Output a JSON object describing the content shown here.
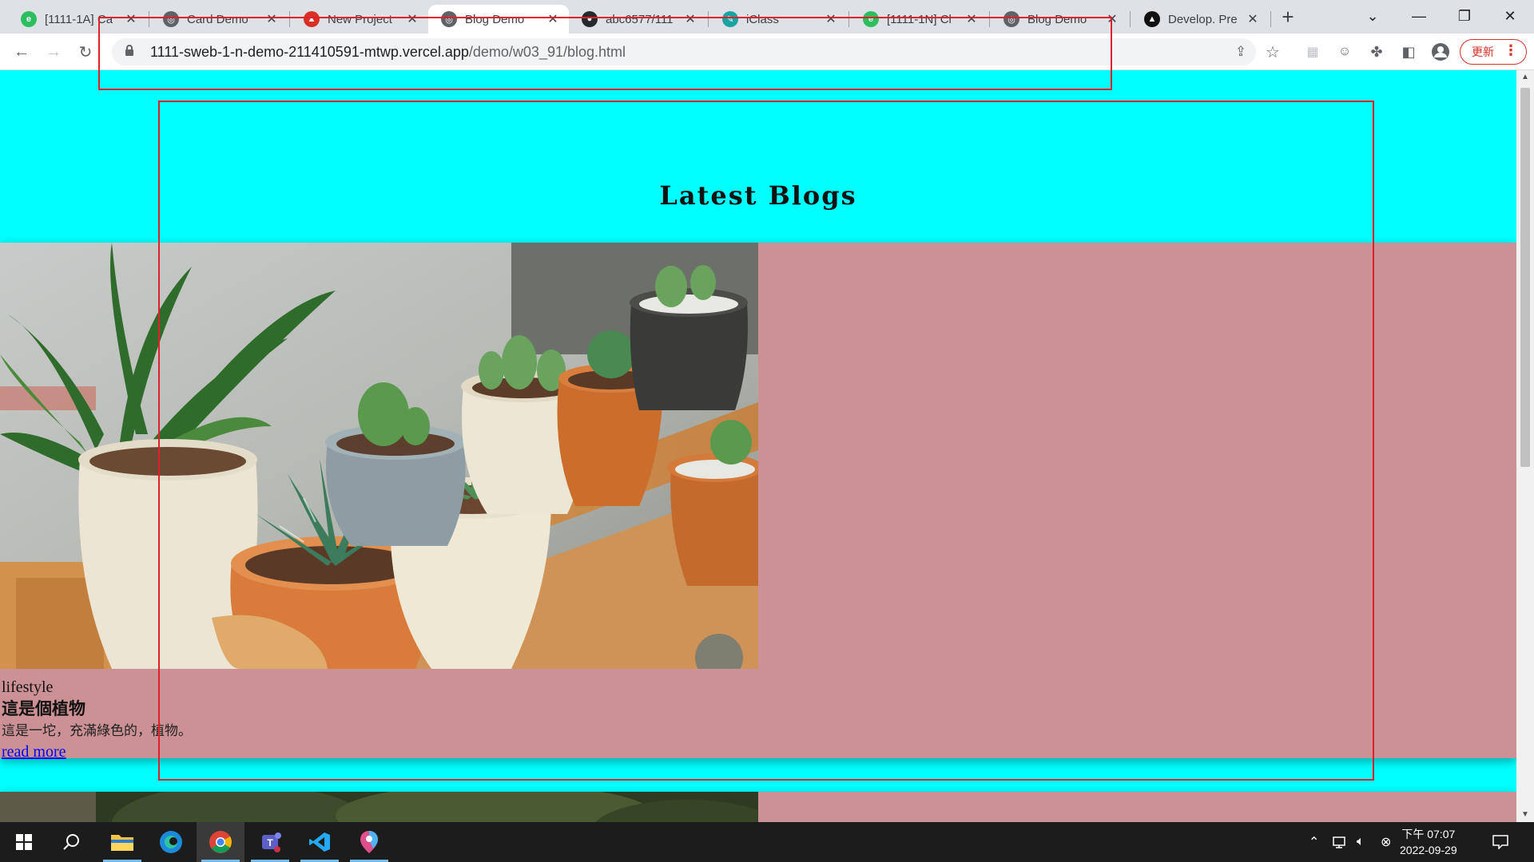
{
  "browser": {
    "tabs": [
      {
        "title": "[1111-1A] Ca",
        "favicon": "evernote-icon",
        "color": "#2dbe60"
      },
      {
        "title": "Card Demo",
        "favicon": "globe-icon",
        "color": "#5f6368"
      },
      {
        "title": "New Project",
        "favicon": "vercel-icon",
        "color": "#d93025"
      },
      {
        "title": "Blog Demo",
        "favicon": "globe-icon",
        "color": "#5f6368",
        "active": true
      },
      {
        "title": "abc6577/111",
        "favicon": "github-icon",
        "color": "#24292f"
      },
      {
        "title": "iClass",
        "favicon": "iclass-icon",
        "color": "#1aa3a3"
      },
      {
        "title": "[1111-1N] Cl",
        "favicon": "evernote-icon",
        "color": "#2dbe60"
      },
      {
        "title": "Blog Demo",
        "favicon": "globe-icon",
        "color": "#5f6368"
      },
      {
        "title": "Develop. Pre",
        "favicon": "vercel-icon",
        "color": "#111111"
      }
    ],
    "url_host": "1111-sweb-1-n-demo-211410591-mtwp.vercel.app",
    "url_path": "/demo/w03_91/blog.html",
    "update_label": "更新"
  },
  "page": {
    "heading": "Latest Blogs",
    "background": "#00ffff",
    "card_color": "#cb9195",
    "cards": [
      {
        "category": "lifestyle",
        "title": "這是個植物",
        "description": "這是一坨，充滿綠色的，植物。",
        "link": "read more"
      }
    ]
  },
  "taskbar": {
    "apps": [
      "windows-start-icon",
      "search-icon",
      "file-explorer-icon",
      "edge-icon",
      "chrome-icon",
      "teams-icon",
      "vscode-icon",
      "maps-pin-icon"
    ],
    "time": "下午 07:07",
    "date": "2022-09-29"
  }
}
